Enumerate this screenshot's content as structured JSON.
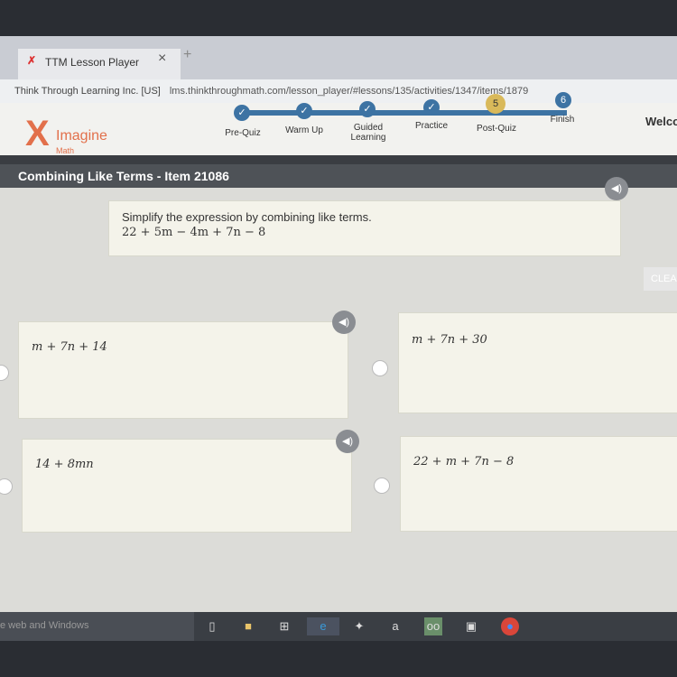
{
  "browser": {
    "tab_title": "TTM Lesson Player",
    "close": "×",
    "new_tab": "+",
    "site_identity": "Think Through Learning Inc. [US]",
    "url": "lms.thinkthroughmath.com/lesson_player/#lessons/135/activities/1347/items/1879"
  },
  "logo": {
    "brand": "Imagine",
    "sub": "Math"
  },
  "progress": {
    "steps": [
      {
        "label": "Pre-Quiz",
        "mark": "✓"
      },
      {
        "label": "Warm Up",
        "mark": "✓"
      },
      {
        "label": "Guided Learning",
        "mark": "✓"
      },
      {
        "label": "Practice",
        "mark": "✓"
      },
      {
        "label": "Post-Quiz",
        "mark": "5",
        "current": true
      },
      {
        "label": "Finish",
        "mark": "6"
      }
    ]
  },
  "welcome": "Welco",
  "item_title": "Combining Like Terms - Item 21086",
  "question": {
    "prompt": "Simplify the expression by combining like terms.",
    "expression": "22 + 5m − 4m + 7n − 8"
  },
  "clear_label": "CLEA",
  "answers": [
    "m + 7n + 14",
    "m + 7n + 30",
    "14 + 8mn",
    "22 + m + 7n − 8"
  ],
  "taskbar": {
    "search": "e web and Windows"
  },
  "colors": {
    "accent": "#3d73a3",
    "current_step": "#d9b95a",
    "logo": "#e2704b"
  }
}
